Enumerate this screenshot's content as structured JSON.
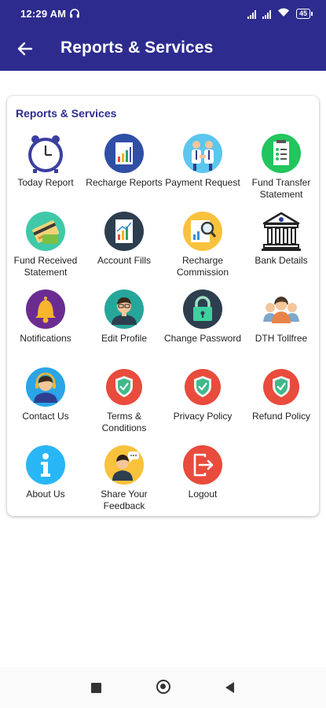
{
  "status": {
    "time": "12:29 AM",
    "battery": "45"
  },
  "header": {
    "title": "Reports & Services"
  },
  "card": {
    "title": "Reports & Services"
  },
  "items": [
    {
      "label": "Today Report",
      "icon": "clock-icon"
    },
    {
      "label": "Recharge Reports",
      "icon": "bar-chart-icon"
    },
    {
      "label": "Payment Request",
      "icon": "handshake-icon"
    },
    {
      "label": "Fund Transfer Statement",
      "icon": "checklist-icon"
    },
    {
      "label": "Fund Received Statement",
      "icon": "credit-card-icon"
    },
    {
      "label": "Account Fills",
      "icon": "report-chart-icon"
    },
    {
      "label": "Recharge Commission",
      "icon": "magnifier-chart-icon"
    },
    {
      "label": "Bank Details",
      "icon": "bank-icon"
    },
    {
      "label": "Notifications",
      "icon": "bell-icon"
    },
    {
      "label": "Edit Profile",
      "icon": "person-icon"
    },
    {
      "label": "Change Password",
      "icon": "lock-icon"
    },
    {
      "label": "DTH Tollfree",
      "icon": "support-team-icon"
    },
    {
      "label": "Contact Us",
      "icon": "headset-agent-icon"
    },
    {
      "label": "Terms & Conditions",
      "icon": "shield-icon"
    },
    {
      "label": "Privacy Policy",
      "icon": "shield-icon"
    },
    {
      "label": "Refund Policy",
      "icon": "shield-icon"
    },
    {
      "label": "About Us",
      "icon": "info-icon"
    },
    {
      "label": "Share Your Feedback",
      "icon": "feedback-icon"
    },
    {
      "label": "Logout",
      "icon": "logout-icon"
    }
  ]
}
